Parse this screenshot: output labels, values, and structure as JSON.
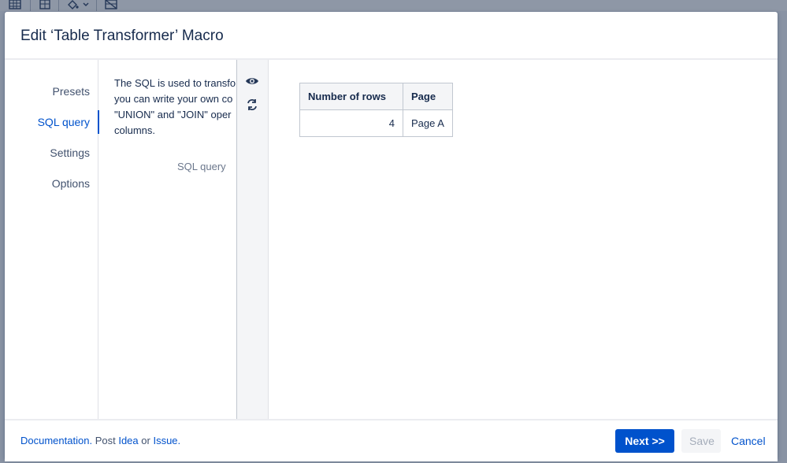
{
  "modal": {
    "title": "Edit ‘Table Transformer’ Macro"
  },
  "nav": {
    "items": [
      {
        "label": "Presets",
        "active": false
      },
      {
        "label": "SQL query",
        "active": true
      },
      {
        "label": "Settings",
        "active": false
      },
      {
        "label": "Options",
        "active": false
      }
    ]
  },
  "description": {
    "lines": [
      "The SQL is used to transfo",
      "you can write your own co",
      "\"UNION\" and \"JOIN\" oper",
      "columns."
    ],
    "field_label": "SQL query"
  },
  "tools": {
    "preview_icon": "eye-icon",
    "refresh_icon": "refresh-icon"
  },
  "result_table": {
    "headers": [
      "Number of rows",
      "Page"
    ],
    "rows": [
      [
        "4",
        "Page A"
      ]
    ]
  },
  "footer": {
    "documentation": "Documentation.",
    "post": "Post",
    "idea": "Idea",
    "or": "or",
    "issue": "Issue.",
    "next_label": "Next >>",
    "save_label": "Save",
    "cancel_label": "Cancel"
  },
  "colors": {
    "accent": "#0052cc",
    "overlay": "#8993a4"
  }
}
